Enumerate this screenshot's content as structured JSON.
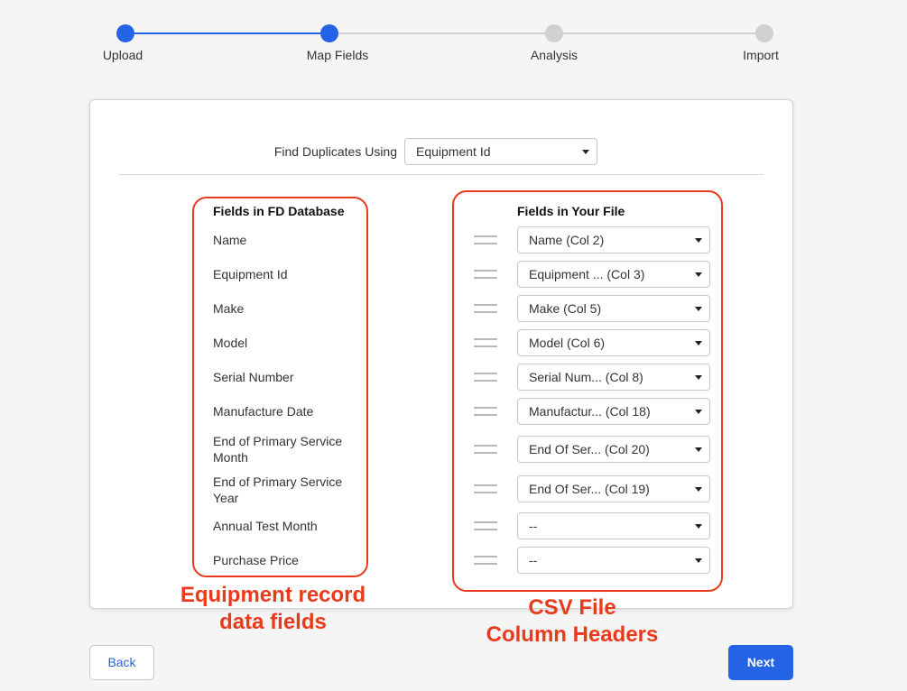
{
  "stepper": {
    "steps": [
      {
        "label": "Upload",
        "state": "done"
      },
      {
        "label": "Map Fields",
        "state": "current"
      },
      {
        "label": "Analysis",
        "state": "pending"
      },
      {
        "label": "Import",
        "state": "pending"
      }
    ],
    "active_color": "#2563e6",
    "inactive_color": "#d0d0d0"
  },
  "duplicates": {
    "label": "Find Duplicates Using",
    "selected": "Equipment Id"
  },
  "columns": {
    "left_header": "Fields in FD Database",
    "right_header": "Fields in Your File"
  },
  "mappings": [
    {
      "field": "Name",
      "value": "Name (Col 2)"
    },
    {
      "field": "Equipment Id",
      "value": "Equipment ... (Col 3)"
    },
    {
      "field": "Make",
      "value": "Make (Col 5)"
    },
    {
      "field": "Model",
      "value": "Model (Col 6)"
    },
    {
      "field": "Serial Number",
      "value": "Serial Num... (Col 8)"
    },
    {
      "field": "Manufacture Date",
      "value": "Manufactur... (Col 18)"
    },
    {
      "field": "End of Primary Service Month",
      "value": "End Of Ser... (Col 20)"
    },
    {
      "field": "End of Primary Service Year",
      "value": "End Of Ser... (Col 19)"
    },
    {
      "field": "Annual Test Month",
      "value": "--"
    },
    {
      "field": "Purchase Price",
      "value": "--"
    }
  ],
  "annotations": {
    "left_line1": "Equipment record",
    "left_line2": "data fields",
    "right_line1": "CSV File",
    "right_line2": "Column Headers",
    "color": "#ea3a1c"
  },
  "buttons": {
    "back_label": "Back",
    "next_label": "Next"
  }
}
